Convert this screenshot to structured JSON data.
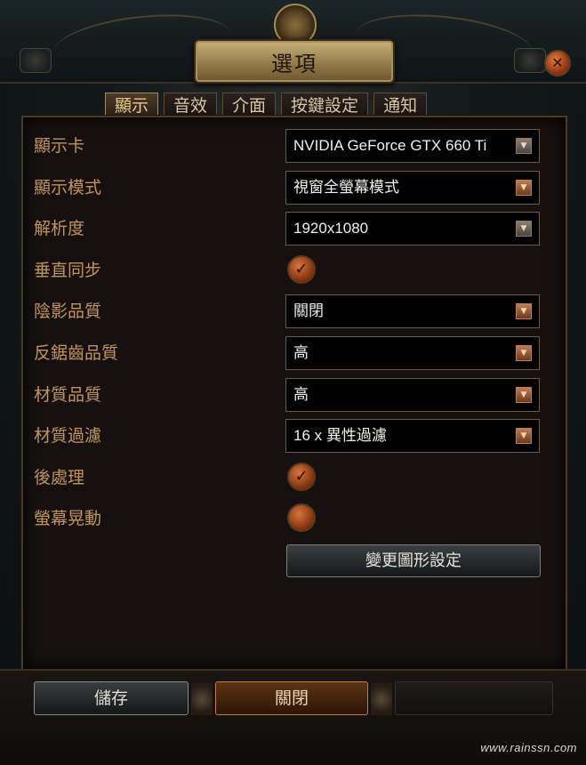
{
  "window": {
    "title": "選項",
    "close_icon": "close-icon"
  },
  "tabs": [
    {
      "label": "顯示",
      "active": true
    },
    {
      "label": "音效",
      "active": false
    },
    {
      "label": "介面",
      "active": false
    },
    {
      "label": "按鍵設定",
      "active": false
    },
    {
      "label": "通知",
      "active": false
    }
  ],
  "settings": {
    "graphics_card": {
      "label": "顯示卡",
      "value": "NVIDIA GeForce GTX 660 Ti"
    },
    "display_mode": {
      "label": "顯示模式",
      "value": "視窗全螢幕模式"
    },
    "resolution": {
      "label": "解析度",
      "value": "1920x1080"
    },
    "vsync": {
      "label": "垂直同步",
      "checked": true
    },
    "shadow_quality": {
      "label": "陰影品質",
      "value": "關閉"
    },
    "antialias_quality": {
      "label": "反鋸齒品質",
      "value": "高"
    },
    "texture_quality": {
      "label": "材質品質",
      "value": "高"
    },
    "texture_filter": {
      "label": "材質過濾",
      "value": "16 x 異性過濾"
    },
    "post_processing": {
      "label": "後處理",
      "checked": true
    },
    "screen_shake": {
      "label": "螢幕晃動",
      "checked": false
    }
  },
  "buttons": {
    "change_graphics": "變更圖形設定",
    "save": "儲存",
    "close": "關閉"
  },
  "watermark": "www.rainssn.com",
  "colors": {
    "label_color": "#c0945a",
    "accent": "#c37b40"
  }
}
